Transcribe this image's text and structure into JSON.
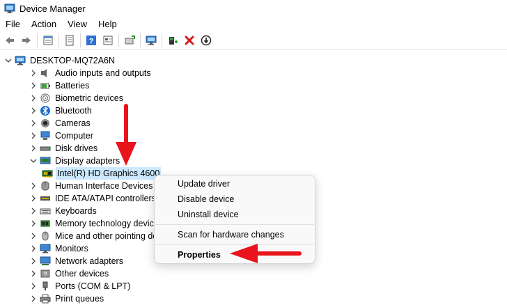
{
  "window": {
    "title": "Device Manager"
  },
  "menu": [
    "File",
    "Action",
    "View",
    "Help"
  ],
  "toolbar": {
    "icons": [
      "back-icon",
      "forward-icon",
      "properties-icon",
      "help-topics-icon",
      "help-icon",
      "view-icon",
      "update-driver-icon",
      "scan-icon",
      "add-driver-icon",
      "uninstall-icon",
      "disable-icon"
    ]
  },
  "tree": {
    "root": "DESKTOP-MQ72A6N",
    "categories": [
      {
        "label": "Audio inputs and outputs",
        "icon": "speaker-icon",
        "expanded": false
      },
      {
        "label": "Batteries",
        "icon": "battery-icon",
        "expanded": false
      },
      {
        "label": "Biometric devices",
        "icon": "fingerprint-icon",
        "expanded": false
      },
      {
        "label": "Bluetooth",
        "icon": "bluetooth-icon",
        "expanded": false
      },
      {
        "label": "Cameras",
        "icon": "camera-icon",
        "expanded": false
      },
      {
        "label": "Computer",
        "icon": "computer-icon",
        "expanded": false
      },
      {
        "label": "Disk drives",
        "icon": "disk-icon",
        "expanded": false
      },
      {
        "label": "Display adapters",
        "icon": "display-adapter-icon",
        "expanded": true
      },
      {
        "label": "Human Interface Devices",
        "icon": "hid-icon",
        "expanded": false
      },
      {
        "label": "IDE ATA/ATAPI controllers",
        "icon": "ide-icon",
        "expanded": false
      },
      {
        "label": "Keyboards",
        "icon": "keyboard-icon",
        "expanded": false
      },
      {
        "label": "Memory technology devices",
        "icon": "memory-icon",
        "expanded": false
      },
      {
        "label": "Mice and other pointing devices",
        "icon": "mouse-icon",
        "expanded": false
      },
      {
        "label": "Monitors",
        "icon": "monitor-icon",
        "expanded": false
      },
      {
        "label": "Network adapters",
        "icon": "network-icon",
        "expanded": false
      },
      {
        "label": "Other devices",
        "icon": "other-device-icon",
        "expanded": false
      },
      {
        "label": "Ports (COM & LPT)",
        "icon": "port-icon",
        "expanded": false
      },
      {
        "label": "Print queues",
        "icon": "printer-icon",
        "expanded": false
      }
    ],
    "selected_child": "Intel(R) HD Graphics 4600"
  },
  "context_menu": {
    "items": [
      "Update driver",
      "Disable device",
      "Uninstall device",
      "Scan for hardware changes",
      "Properties"
    ]
  },
  "colors": {
    "selection": "#cce8ff",
    "annotation_arrow": "#e8131b"
  }
}
